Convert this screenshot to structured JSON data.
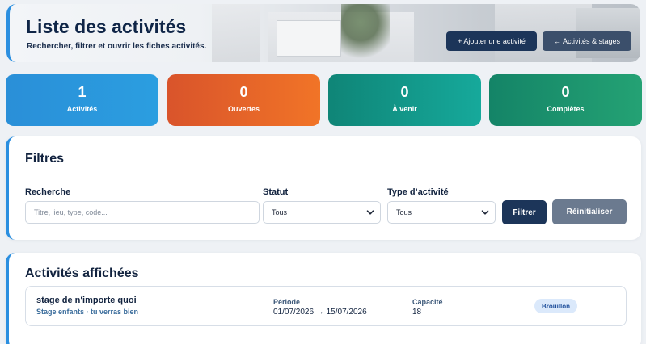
{
  "header": {
    "title": "Liste des activités",
    "subtitle": "Rechercher, filtrer et ouvrir les fiches activités.",
    "add_button": "+ Ajouter une activité",
    "back_button": "← Activités & stages"
  },
  "stats": [
    {
      "value": "1",
      "label": "Activités",
      "color": "#2b95dc"
    },
    {
      "value": "0",
      "label": "Ouvertes",
      "color": "#e8642a"
    },
    {
      "value": "0",
      "label": "À venir",
      "color": "#12978a"
    },
    {
      "value": "0",
      "label": "Complètes",
      "color": "#1c936d"
    }
  ],
  "filters": {
    "title": "Filtres",
    "search_label": "Recherche",
    "search_placeholder": "Titre, lieu, type, code...",
    "status_label": "Statut",
    "status_value": "Tous",
    "type_label": "Type d’activité",
    "type_value": "Tous",
    "filter_button": "Filtrer",
    "reset_button": "Réinitialiser"
  },
  "activities": {
    "title": "Activités affichées",
    "period_header": "Période",
    "capacity_header": "Capacité",
    "items": [
      {
        "name": "stage de n'importe quoi",
        "meta": "Stage enfants · tu verras bien",
        "period": "01/07/2026 → 15/07/2026",
        "capacity": "18",
        "status": "Brouillon"
      }
    ]
  }
}
